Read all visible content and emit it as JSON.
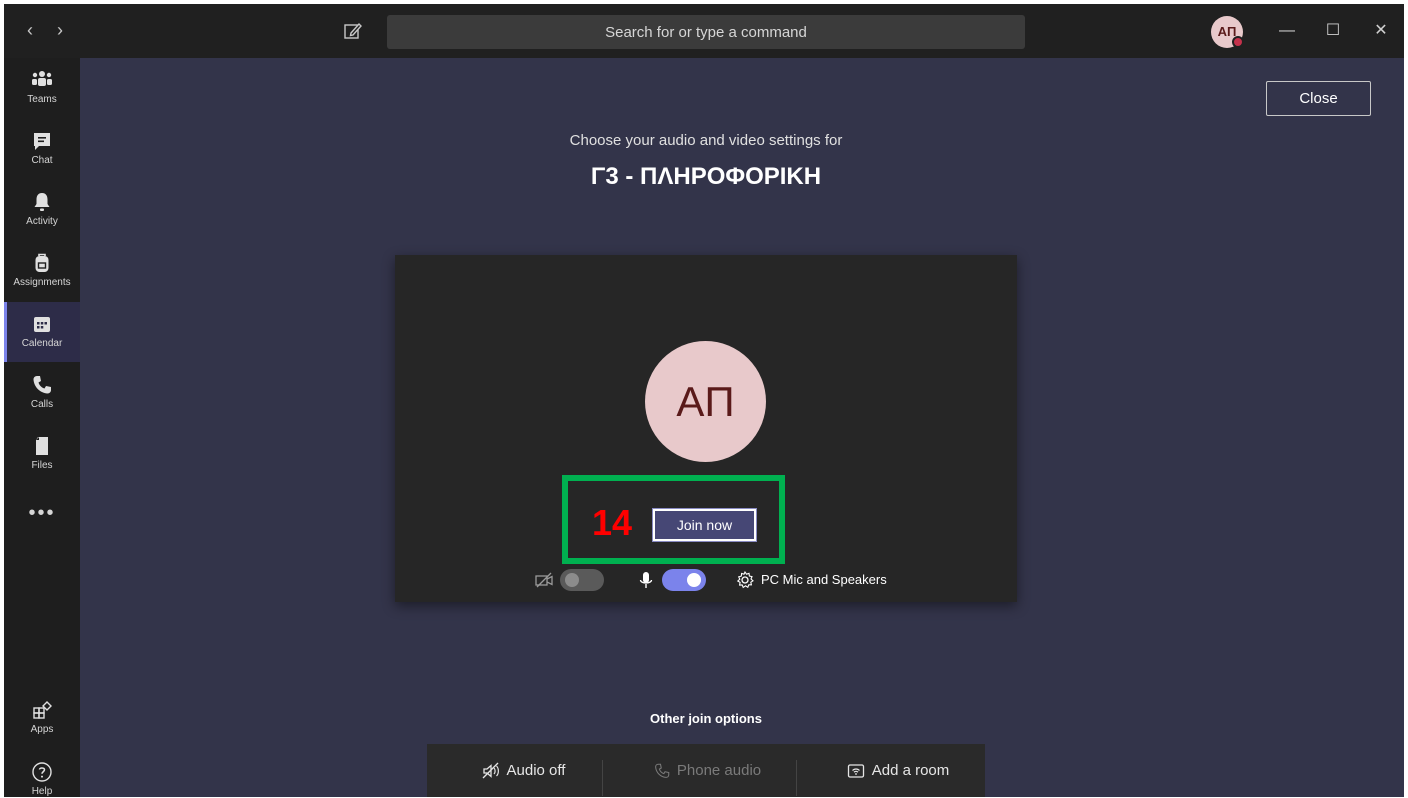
{
  "titlebar": {
    "back_icon": "‹",
    "forward_icon": "›",
    "search_placeholder": "Search for or type a command",
    "avatar_initials": "ΑΠ",
    "minimize_icon": "—",
    "maximize_icon": "☐",
    "close_icon": "✕"
  },
  "rail": {
    "items": [
      {
        "label": "Teams",
        "icon": "teams-icon"
      },
      {
        "label": "Chat",
        "icon": "chat-icon"
      },
      {
        "label": "Activity",
        "icon": "bell-icon"
      },
      {
        "label": "Assignments",
        "icon": "backpack-icon"
      },
      {
        "label": "Calendar",
        "icon": "calendar-icon",
        "active": true
      },
      {
        "label": "Calls",
        "icon": "phone-icon"
      },
      {
        "label": "Files",
        "icon": "file-icon"
      }
    ],
    "more": "•••",
    "apps_label": "Apps",
    "help_label": "Help"
  },
  "main": {
    "close_label": "Close",
    "subtitle": "Choose your audio and video settings for",
    "meeting_title": "Γ3 - ΠΛΗΡΟΦΟΡΙΚΗ",
    "avatar_initials": "ΑΠ",
    "step_number": "14",
    "join_label": "Join now",
    "video_toggle": "off",
    "mic_toggle": "on",
    "device_label": "PC Mic and Speakers",
    "other_join_title": "Other join options",
    "options": [
      {
        "label": "Audio off",
        "icon": "speaker-off-icon",
        "enabled": true
      },
      {
        "label": "Phone audio",
        "icon": "phone-icon",
        "enabled": false
      },
      {
        "label": "Add a room",
        "icon": "cast-room-icon",
        "enabled": true
      }
    ]
  },
  "colors": {
    "background": "#33344a",
    "titlebar": "#202020",
    "rail": "#1e1e1e",
    "accent": "#7b83eb",
    "join_button": "#464775",
    "highlight_box": "#00b050",
    "step_number": "#ff0000",
    "avatar_bg": "#e8c9cb"
  }
}
